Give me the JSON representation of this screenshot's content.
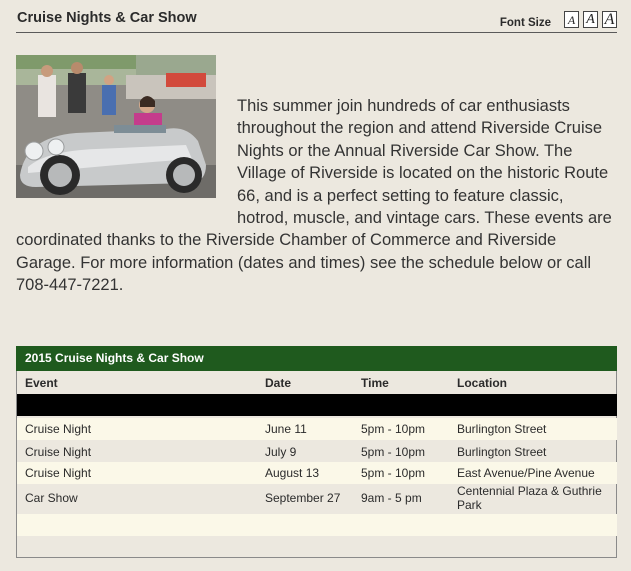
{
  "header": {
    "title": "Cruise Nights & Car Show",
    "font_size_label": "Font Size",
    "font_buttons": [
      "A",
      "A",
      "A"
    ]
  },
  "intro": {
    "text": "This summer join hundreds of car enthusiasts throughout the region and attend Riverside Cruise Nights or the Annual Riverside Car Show. The Village of Riverside is located on the historic Route 66, and is a perfect setting to feature classic, hotrod, muscle, and vintage cars. These events are coordinated thanks to the Riverside Chamber of Commerce and Riverside Garage. For more information (dates and times) see the schedule below or call 708-447-7221."
  },
  "schedule": {
    "title": "2015 Cruise Nights & Car Show",
    "columns": [
      "Event",
      "Date",
      "Time",
      "Location"
    ],
    "rows": [
      {
        "event": "Cruise Night",
        "date": "June 11",
        "time": "5pm - 10pm",
        "location": "Burlington Street"
      },
      {
        "event": "Cruise Night",
        "date": "July 9",
        "time": "5pm - 10pm",
        "location": "Burlington Street"
      },
      {
        "event": "Cruise Night",
        "date": "August 13",
        "time": "5pm - 10pm",
        "location": "East Avenue/Pine Avenue"
      },
      {
        "event": "Car Show",
        "date": "September 27",
        "time": "9am - 5 pm",
        "location": "Centennial Plaza & Guthrie Park"
      }
    ]
  },
  "colors": {
    "background": "#ece8df",
    "table_header_green": "#1f5a1e",
    "row_light": "#fbf8e8"
  }
}
